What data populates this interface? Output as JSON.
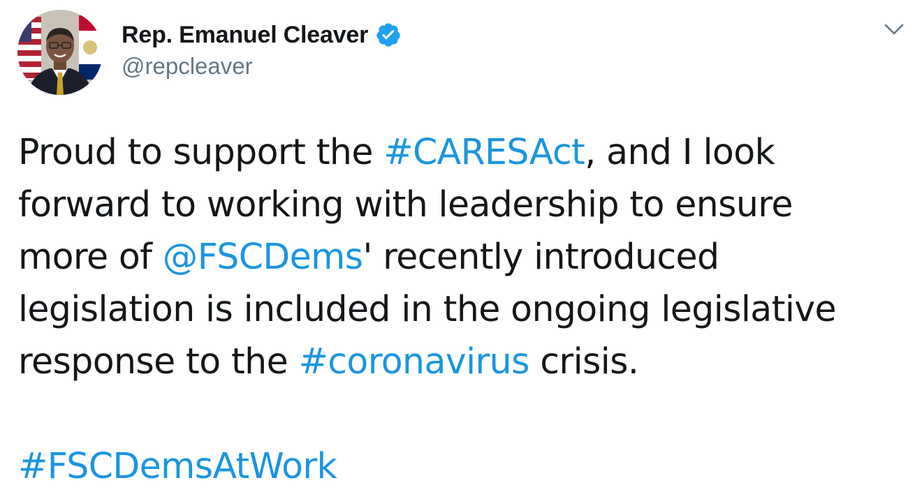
{
  "tweet": {
    "author": {
      "display_name": "Rep. Emanuel Cleaver",
      "handle": "@repcleaver",
      "verified": true
    },
    "body": {
      "line1": {
        "a": "Proud to support the ",
        "b": "#CARESAct",
        "c": ", and I look"
      },
      "line2": "forward to working with leadership to ensure",
      "line3": {
        "a": "more of ",
        "b": "@FSCDems",
        "c": "' recently introduced"
      },
      "line4": "legislation is included in the ongoing legislative",
      "line5": {
        "a": "response to the ",
        "b": "#coronavirus",
        "c": " crisis."
      },
      "line7": "#FSCDemsAtWork"
    },
    "icons": {
      "verified": "verified-badge-icon",
      "menu": "chevron-down-icon"
    },
    "colors": {
      "link": "#1b95e0",
      "text": "#14171a",
      "secondary": "#657786",
      "verified": "#1da1f2"
    }
  }
}
